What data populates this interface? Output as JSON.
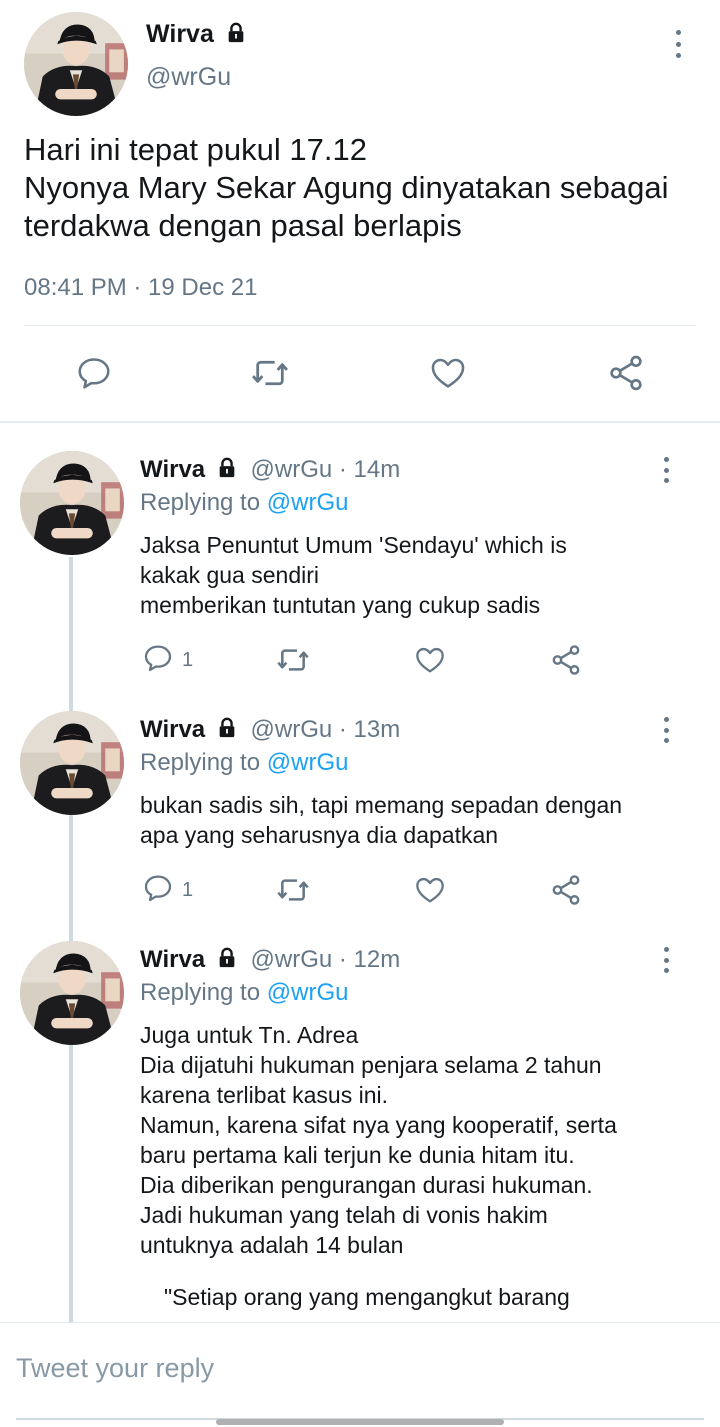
{
  "main_tweet": {
    "name": "Wirva",
    "handle": "@wrGu",
    "lines": [
      "Hari ini tepat pukul 17.12",
      "Nyonya Mary Sekar Agung dinyatakan sebagai",
      "terdakwa dengan pasal berlapis"
    ],
    "timestamp": "08:41 PM · 19 Dec 21",
    "actions": [
      "reply-icon",
      "retweet-icon",
      "like-icon",
      "share-icon"
    ]
  },
  "replies": [
    {
      "name": "Wirva",
      "meta": "@wrGu · 14m",
      "replying_label": "Replying to",
      "replying_to": "@wrGu",
      "lines": [
        "Jaksa Penuntut Umum 'Sendayu' which is",
        "kakak gua sendiri",
        "memberikan tuntutan yang cukup sadis"
      ],
      "reply_count": "1"
    },
    {
      "name": "Wirva",
      "meta": "@wrGu · 13m",
      "replying_label": "Replying to",
      "replying_to": "@wrGu",
      "lines": [
        "bukan sadis sih, tapi memang sepadan dengan",
        "apa yang seharusnya dia dapatkan"
      ],
      "reply_count": "1"
    },
    {
      "name": "Wirva",
      "meta": "@wrGu · 12m",
      "replying_label": "Replying to",
      "replying_to": "@wrGu",
      "lines": [
        "Juga untuk Tn. Adrea",
        "Dia dijatuhi hukuman penjara selama 2 tahun",
        "karena terlibat kasus ini.",
        "Namun, karena sifat nya yang kooperatif, serta",
        "baru pertama kali terjun ke dunia hitam itu.",
        "Dia diberikan pengurangan durasi hukuman.",
        "Jadi hukuman yang telah di vonis hakim",
        "untuknya adalah 14 bulan"
      ],
      "quote_line": "\"Setiap orang yang mengangkut barang"
    }
  ],
  "reply_bar": {
    "placeholder": "Tweet your reply"
  },
  "colors": {
    "text": "#14171a",
    "secondary": "#657786",
    "link": "#1da1f2",
    "divider": "#e1e8ed"
  }
}
